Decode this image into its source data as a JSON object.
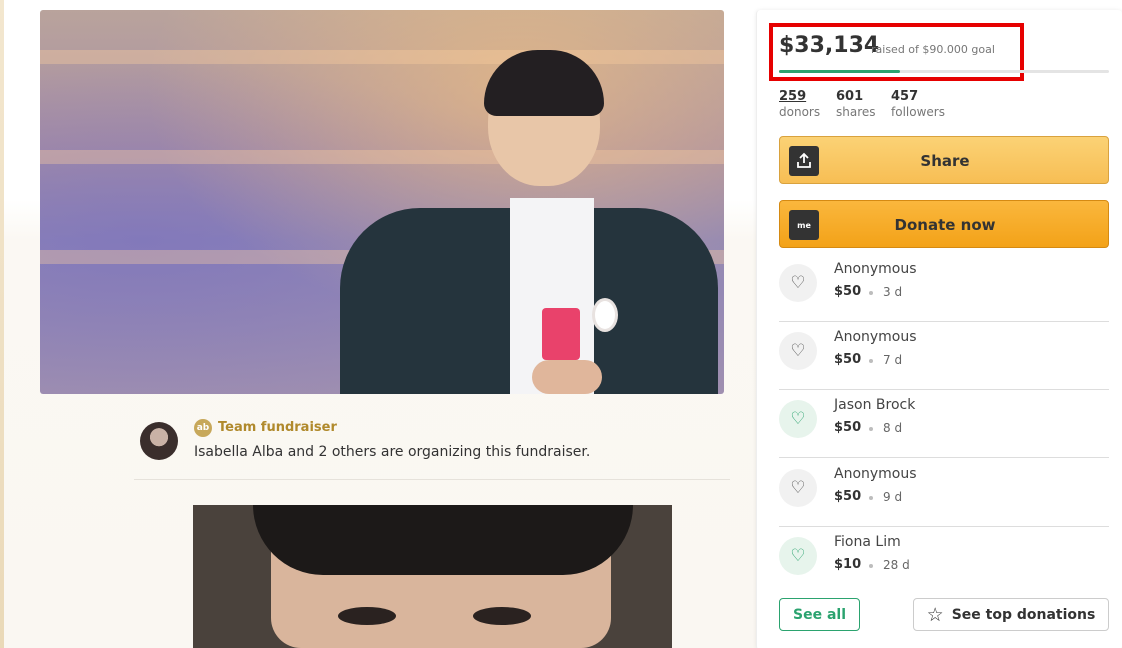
{
  "fundraiser": {
    "team_label": "Team fundraiser",
    "team_icon_text": "ab",
    "organizer_text": "Isabella Alba and 2 others are organizing this fundraiser."
  },
  "sidebar": {
    "amount": "$33,134",
    "goal_text": "raised of $90.000 goal",
    "progress_fraction": 0.368,
    "stats": [
      {
        "value": "259",
        "label": "donors"
      },
      {
        "value": "601",
        "label": "shares"
      },
      {
        "value": "457",
        "label": "followers"
      }
    ],
    "share_label": "Share",
    "share_icon": "upload-icon",
    "donate_label": "Donate now",
    "donate_icon_text": "me",
    "donations": [
      {
        "name": "Anonymous",
        "amount": "$50",
        "age": "3 d"
      },
      {
        "name": "Anonymous",
        "amount": "$50",
        "age": "7 d"
      },
      {
        "name": "Jason Brock",
        "amount": "$50",
        "age": "8 d"
      },
      {
        "name": "Anonymous",
        "amount": "$50",
        "age": "9 d"
      },
      {
        "name": "Fiona Lim",
        "amount": "$10",
        "age": "28 d"
      }
    ],
    "see_all_label": "See all",
    "see_top_label": "See top donations"
  },
  "colors": {
    "accent_green": "#2ba36f",
    "donate_orange": "#f3a218",
    "share_yellow": "#f7be54",
    "highlight_red": "#e60000"
  }
}
